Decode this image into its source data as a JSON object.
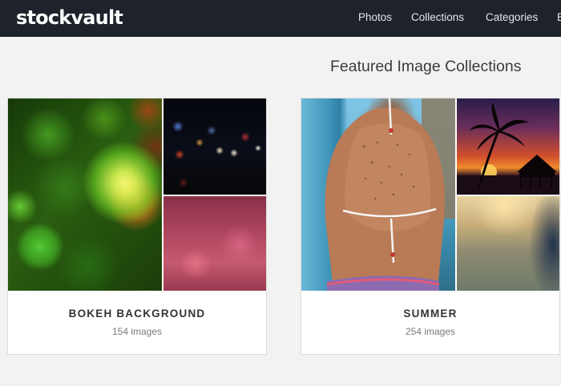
{
  "header": {
    "logo": "stockvault",
    "nav": [
      "Photos",
      "Collections",
      "Categories",
      "B"
    ]
  },
  "main": {
    "section_title": "Featured Image Collections",
    "collections": [
      {
        "title": "BOKEH BACKGROUND",
        "count": "154 images"
      },
      {
        "title": "SUMMER",
        "count": "254 images"
      }
    ]
  },
  "colors": {
    "topbar": "#1d222b",
    "background": "#f2f2f2",
    "card": "#ffffff"
  }
}
